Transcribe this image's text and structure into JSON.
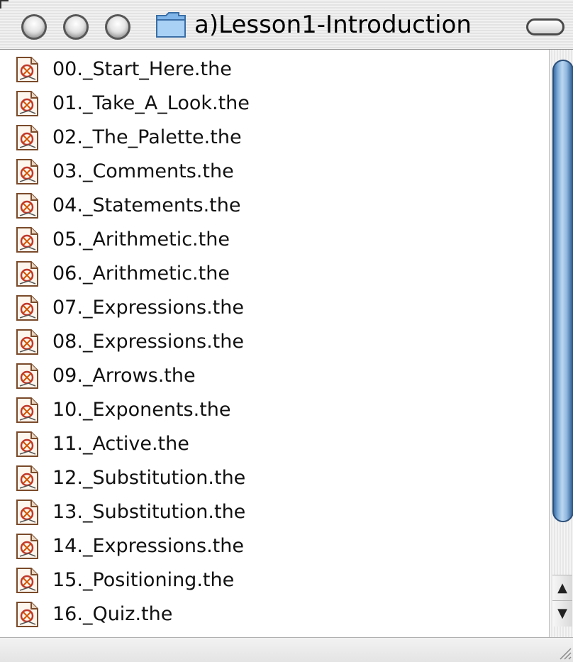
{
  "window": {
    "title": "a)Lesson1-Introduction",
    "folder_icon": "folder-icon"
  },
  "files": [
    {
      "name": "00._Start_Here.the",
      "icon": "document-icon"
    },
    {
      "name": "01._Take_A_Look.the",
      "icon": "document-icon"
    },
    {
      "name": "02._The_Palette.the",
      "icon": "document-icon"
    },
    {
      "name": "03._Comments.the",
      "icon": "document-icon"
    },
    {
      "name": "04._Statements.the",
      "icon": "document-icon"
    },
    {
      "name": "05._Arithmetic.the",
      "icon": "document-icon"
    },
    {
      "name": "06._Arithmetic.the",
      "icon": "document-icon"
    },
    {
      "name": "07._Expressions.the",
      "icon": "document-icon"
    },
    {
      "name": "08._Expressions.the",
      "icon": "document-icon"
    },
    {
      "name": "09._Arrows.the",
      "icon": "document-icon"
    },
    {
      "name": "10._Exponents.the",
      "icon": "document-icon"
    },
    {
      "name": "11._Active.the",
      "icon": "document-icon"
    },
    {
      "name": "12._Substitution.the",
      "icon": "document-icon"
    },
    {
      "name": "13._Substitution.the",
      "icon": "document-icon"
    },
    {
      "name": "14._Expressions.the",
      "icon": "document-icon"
    },
    {
      "name": "15._Positioning.the",
      "icon": "document-icon"
    },
    {
      "name": "16._Quiz.the",
      "icon": "document-icon"
    }
  ],
  "scrollbar": {
    "up_glyph": "▲",
    "down_glyph": "▼"
  },
  "colors": {
    "scroll_thumb": "#6f9fd0",
    "title_text": "#000000"
  }
}
